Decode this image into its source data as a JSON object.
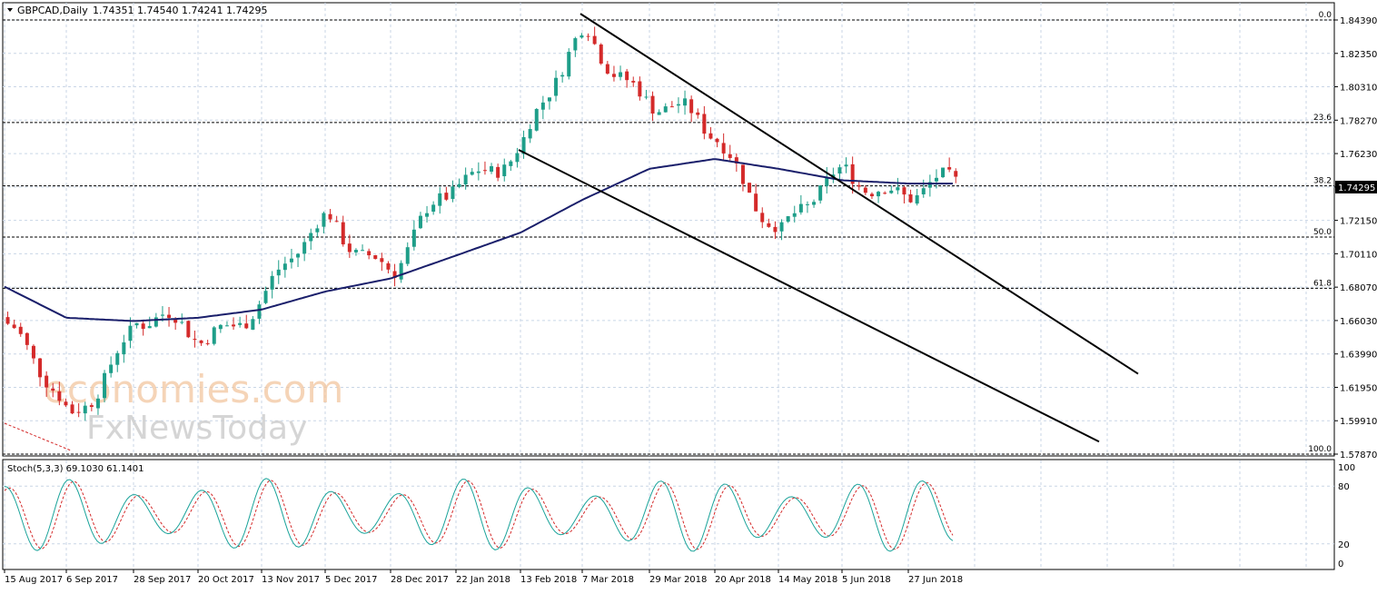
{
  "header": {
    "symbol_label": "GBPCAD,Daily",
    "ohlc": "1.74351 1.74540 1.74241 1.74295"
  },
  "price_badge": "1.74295",
  "watermark": {
    "line1": "economies.com",
    "line2": "FxNewsToday"
  },
  "colors": {
    "bull": "#1e9e89",
    "bear": "#d42a2a",
    "ma": "#1a1f6b",
    "stoch_main": "#1aa39a",
    "stoch_signal": "#d42a2a",
    "grid": "#c9d6e6",
    "badge": "#000000"
  },
  "chart_data": [
    {
      "type": "candlestick",
      "price_axis": {
        "ylim": [
          1.5787,
          1.8439
        ],
        "ticks": [
          "1.84390",
          "1.82350",
          "1.80310",
          "1.78270",
          "1.76230",
          "1.74190",
          "1.72150",
          "1.70110",
          "1.68070",
          "1.66030",
          "1.63990",
          "1.61950",
          "1.59910",
          "1.57870"
        ]
      },
      "date_axis": {
        "ticks": [
          "15 Aug 2017",
          "6 Sep 2017",
          "28 Sep 2017",
          "20 Oct 2017",
          "13 Nov 2017",
          "5 Dec 2017",
          "28 Dec 2017",
          "22 Jan 2018",
          "13 Feb 2018",
          "7 Mar 2018",
          "29 Mar 2018",
          "20 Apr 2018",
          "14 May 2018",
          "5 Jun 2018",
          "27 Jun 2018"
        ]
      },
      "fibonacci": [
        {
          "label": "0.0",
          "price": 1.8439
        },
        {
          "label": "23.6",
          "price": 1.7813
        },
        {
          "label": "38.2",
          "price": 1.7426
        },
        {
          "label": "50.0",
          "price": 1.7113
        },
        {
          "label": "61.8",
          "price": 1.68
        },
        {
          "label": "100.0",
          "price": 1.5787
        }
      ],
      "price_path": [
        [
          "15 Aug 2017",
          1.655
        ],
        [
          "6 Sep 2017",
          1.6
        ],
        [
          "28 Sep 2017",
          1.66
        ],
        [
          "20 Oct 2017",
          1.65
        ],
        [
          "13 Nov 2017",
          1.675
        ],
        [
          "5 Dec 2017",
          1.722
        ],
        [
          "28 Dec 2017",
          1.692
        ],
        [
          "22 Jan 2018",
          1.745
        ],
        [
          "13 Feb 2018",
          1.77
        ],
        [
          "7 Mar 2018",
          1.835
        ],
        [
          "29 Mar 2018",
          1.795
        ],
        [
          "20 Apr 2018",
          1.77
        ],
        [
          "14 May 2018",
          1.716
        ],
        [
          "5 Jun 2018",
          1.748
        ],
        [
          "27 Jun 2018",
          1.741
        ]
      ],
      "moving_average": [
        [
          "15 Aug 2017",
          1.681
        ],
        [
          "6 Sep 2017",
          1.662
        ],
        [
          "28 Sep 2017",
          1.66
        ],
        [
          "20 Oct 2017",
          1.662
        ],
        [
          "13 Nov 2017",
          1.667
        ],
        [
          "5 Dec 2017",
          1.678
        ],
        [
          "28 Dec 2017",
          1.686
        ],
        [
          "22 Jan 2018",
          1.7
        ],
        [
          "13 Feb 2018",
          1.714
        ],
        [
          "7 Mar 2018",
          1.734
        ],
        [
          "29 Mar 2018",
          1.753
        ],
        [
          "20 Apr 2018",
          1.759
        ],
        [
          "14 May 2018",
          1.753
        ],
        [
          "5 Jun 2018",
          1.746
        ],
        [
          "27 Jun 2018",
          1.744
        ]
      ],
      "channel": {
        "upper": [
          [
            "7 Mar 2018",
            1.847
          ],
          [
            "27 Jun 2018",
            1.7184
          ]
        ],
        "lower": [
          [
            "13 Feb 2018",
            1.764
          ],
          [
            "27 Jun 2018",
            1.6449
          ]
        ]
      }
    },
    {
      "type": "line",
      "title": "Stoch(5,3,3) 69.1030 61.1401",
      "ylim": [
        0,
        100
      ],
      "ticks": [
        "100",
        "80",
        "20",
        "0"
      ],
      "levels": [
        80,
        20
      ]
    }
  ]
}
